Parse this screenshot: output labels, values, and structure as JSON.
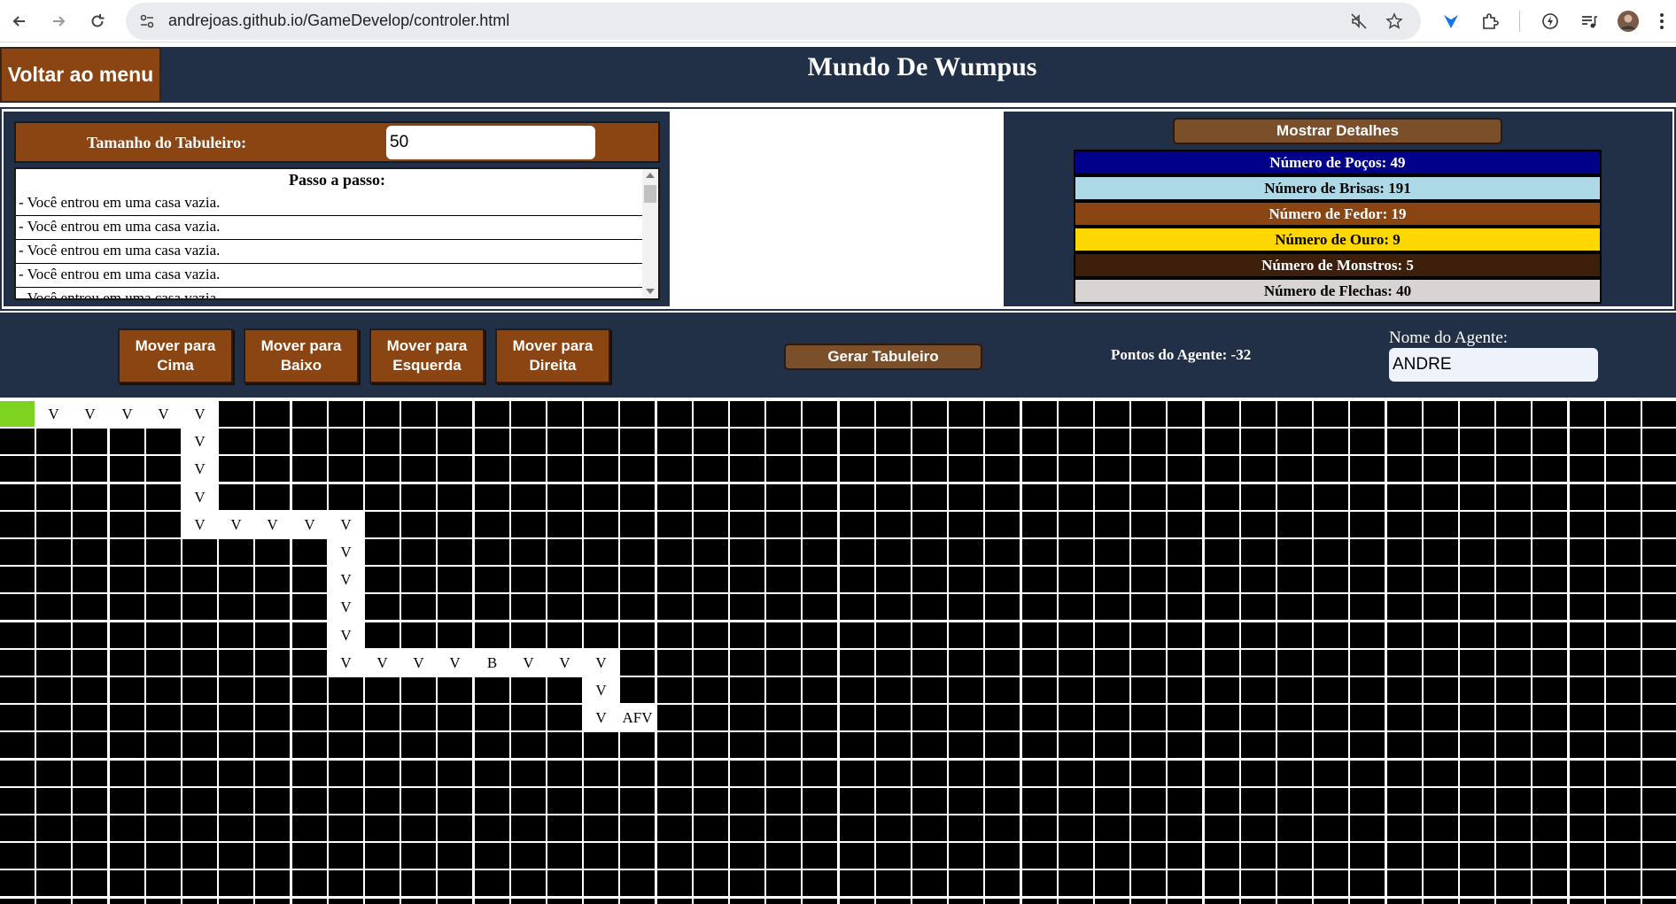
{
  "browser": {
    "url": "andrejoas.github.io/GameDevelop/controler.html"
  },
  "header": {
    "back_label": "Voltar ao menu",
    "title": "Mundo De Wumpus"
  },
  "settings": {
    "board_size_label": "Tamanho do Tabuleiro:",
    "board_size_value": "50"
  },
  "log": {
    "title": "Passo a passo:",
    "entries": [
      "- Você entrou em uma casa vazia.",
      "- Você entrou em uma casa vazia.",
      "- Você entrou em uma casa vazia.",
      "- Você entrou em uma casa vazia.",
      "- Você entrou em uma casa vazia."
    ]
  },
  "details": {
    "button_label": "Mostrar Detalhes",
    "stats": [
      {
        "label": "Número de Poços: 49",
        "bg": "#00008b",
        "fg": "#ffffff"
      },
      {
        "label": "Número de Brisas: 191",
        "bg": "#add8e6",
        "fg": "#000000"
      },
      {
        "label": "Número de Fedor: 19",
        "bg": "#8b4513",
        "fg": "#ffffff"
      },
      {
        "label": "Número de Ouro: 9",
        "bg": "#ffd700",
        "fg": "#000000"
      },
      {
        "label": "Número de Monstros: 5",
        "bg": "#3d1f0c",
        "fg": "#ffffff"
      },
      {
        "label": "Número de Flechas: 40",
        "bg": "#d9d4d4",
        "fg": "#000000"
      }
    ]
  },
  "controls": {
    "move_up": "Mover para Cima",
    "move_down": "Mover para Baixo",
    "move_left": "Mover para Esquerda",
    "move_right": "Mover para Direita",
    "generate": "Gerar Tabuleiro",
    "points": "Pontos do Agente: -32",
    "agent_name_label": "Nome do Agente:",
    "agent_name_value": "ANDRE"
  },
  "board": {
    "agent_color": "#7ed321",
    "visited_cells": [
      {
        "row": 0,
        "col": 1,
        "text": "V"
      },
      {
        "row": 0,
        "col": 2,
        "text": "V"
      },
      {
        "row": 0,
        "col": 3,
        "text": "V"
      },
      {
        "row": 0,
        "col": 4,
        "text": "V"
      },
      {
        "row": 0,
        "col": 5,
        "text": "V"
      },
      {
        "row": 1,
        "col": 5,
        "text": "V"
      },
      {
        "row": 2,
        "col": 5,
        "text": "V"
      },
      {
        "row": 3,
        "col": 5,
        "text": "V"
      },
      {
        "row": 4,
        "col": 5,
        "text": "V"
      },
      {
        "row": 4,
        "col": 6,
        "text": "V"
      },
      {
        "row": 4,
        "col": 7,
        "text": "V"
      },
      {
        "row": 4,
        "col": 8,
        "text": "V"
      },
      {
        "row": 4,
        "col": 9,
        "text": "V"
      },
      {
        "row": 5,
        "col": 9,
        "text": "V"
      },
      {
        "row": 6,
        "col": 9,
        "text": "V"
      },
      {
        "row": 7,
        "col": 9,
        "text": "V"
      },
      {
        "row": 8,
        "col": 9,
        "text": "V"
      },
      {
        "row": 9,
        "col": 9,
        "text": "V"
      },
      {
        "row": 9,
        "col": 10,
        "text": "V"
      },
      {
        "row": 9,
        "col": 11,
        "text": "V"
      },
      {
        "row": 9,
        "col": 12,
        "text": "V"
      },
      {
        "row": 9,
        "col": 13,
        "text": "B"
      },
      {
        "row": 9,
        "col": 14,
        "text": "V"
      },
      {
        "row": 9,
        "col": 15,
        "text": "V"
      },
      {
        "row": 9,
        "col": 16,
        "text": "V"
      },
      {
        "row": 10,
        "col": 16,
        "text": "V"
      },
      {
        "row": 11,
        "col": 16,
        "text": "V"
      },
      {
        "row": 11,
        "col": 17,
        "text": "AFV"
      }
    ],
    "agent_cell": {
      "row": 0,
      "col": 0
    }
  }
}
